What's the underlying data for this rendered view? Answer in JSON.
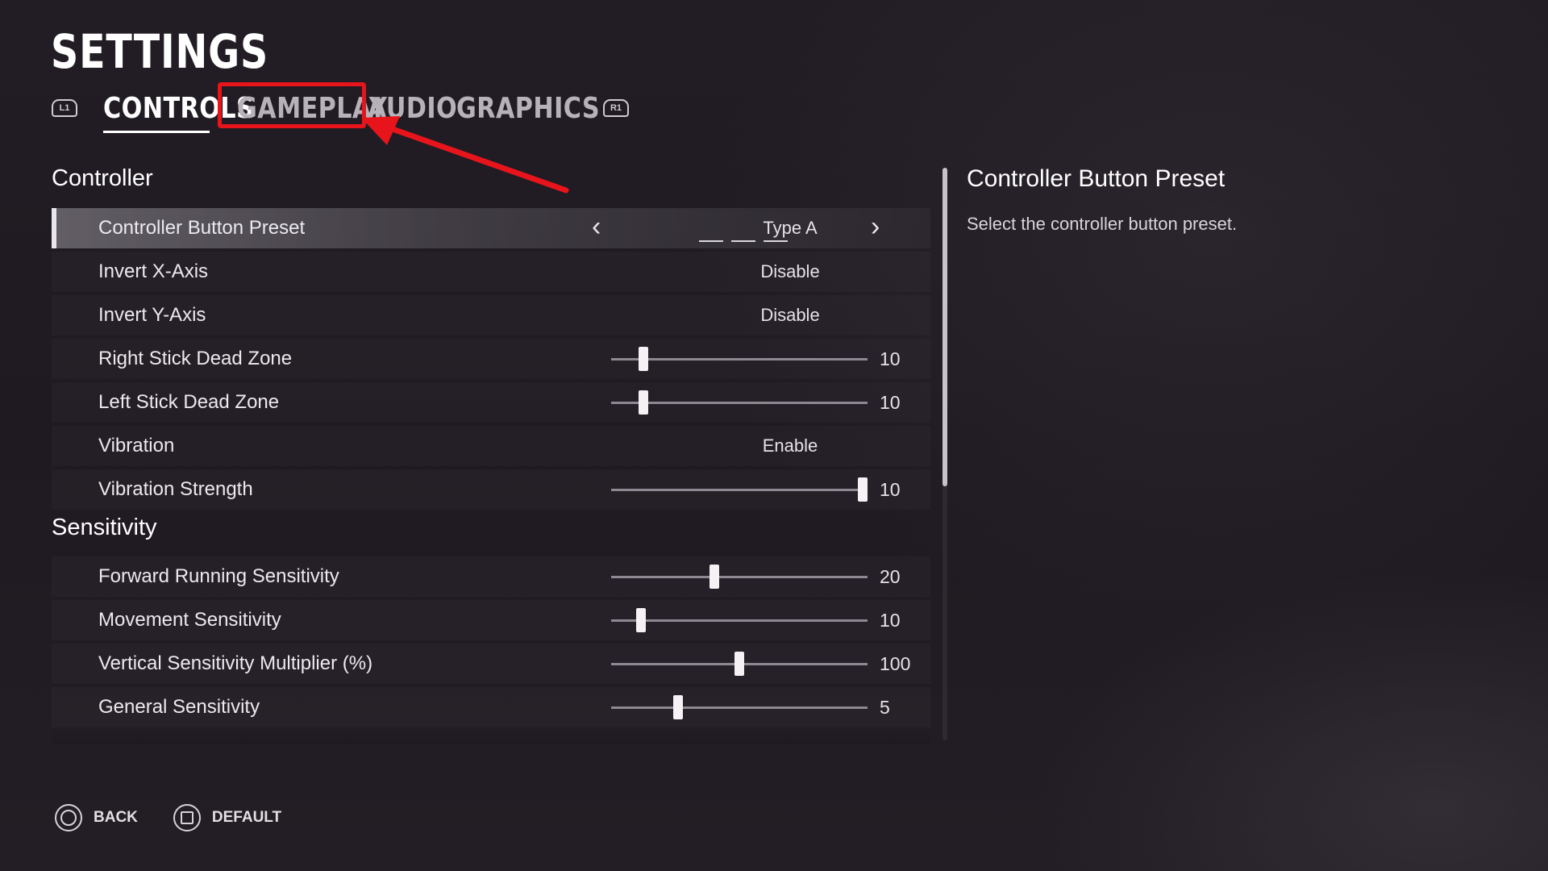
{
  "page": {
    "title": "SETTINGS"
  },
  "tabs": {
    "left_shoulder": "L1",
    "right_shoulder": "R1",
    "items": [
      {
        "label": "CONTROLS",
        "active": true
      },
      {
        "label": "GAMEPLAY",
        "active": false,
        "highlighted": true
      },
      {
        "label": "AUDIO",
        "active": false
      },
      {
        "label": "GRAPHICS",
        "active": false
      }
    ]
  },
  "sections": {
    "controller": "Controller",
    "sensitivity": "Sensitivity"
  },
  "settings": [
    {
      "label": "Controller Button Preset",
      "type": "selector",
      "value": "Type A",
      "selected": true
    },
    {
      "label": "Invert X-Axis",
      "type": "toggle",
      "value": "Disable"
    },
    {
      "label": "Invert Y-Axis",
      "type": "toggle",
      "value": "Disable"
    },
    {
      "label": "Right Stick Dead Zone",
      "type": "slider",
      "value": "10",
      "fraction": 0.11
    },
    {
      "label": "Left Stick Dead Zone",
      "type": "slider",
      "value": "10",
      "fraction": 0.11
    },
    {
      "label": "Vibration",
      "type": "toggle",
      "value": "Enable"
    },
    {
      "label": "Vibration Strength",
      "type": "slider",
      "value": "10",
      "fraction": 1.0
    },
    {
      "label": "Forward Running Sensitivity",
      "type": "slider",
      "value": "20",
      "fraction": 0.4
    },
    {
      "label": "Movement Sensitivity",
      "type": "slider",
      "value": "10",
      "fraction": 0.1
    },
    {
      "label": "Vertical Sensitivity Multiplier (%)",
      "type": "slider",
      "value": "100",
      "fraction": 0.5
    },
    {
      "label": "General Sensitivity",
      "type": "slider",
      "value": "5",
      "fraction": 0.25
    }
  ],
  "detail": {
    "title": "Controller Button Preset",
    "description": "Select the controller button preset."
  },
  "footer": {
    "back": "BACK",
    "default": "DEFAULT"
  },
  "colors": {
    "highlight": "#e8141c",
    "background": "#1e1a20"
  }
}
